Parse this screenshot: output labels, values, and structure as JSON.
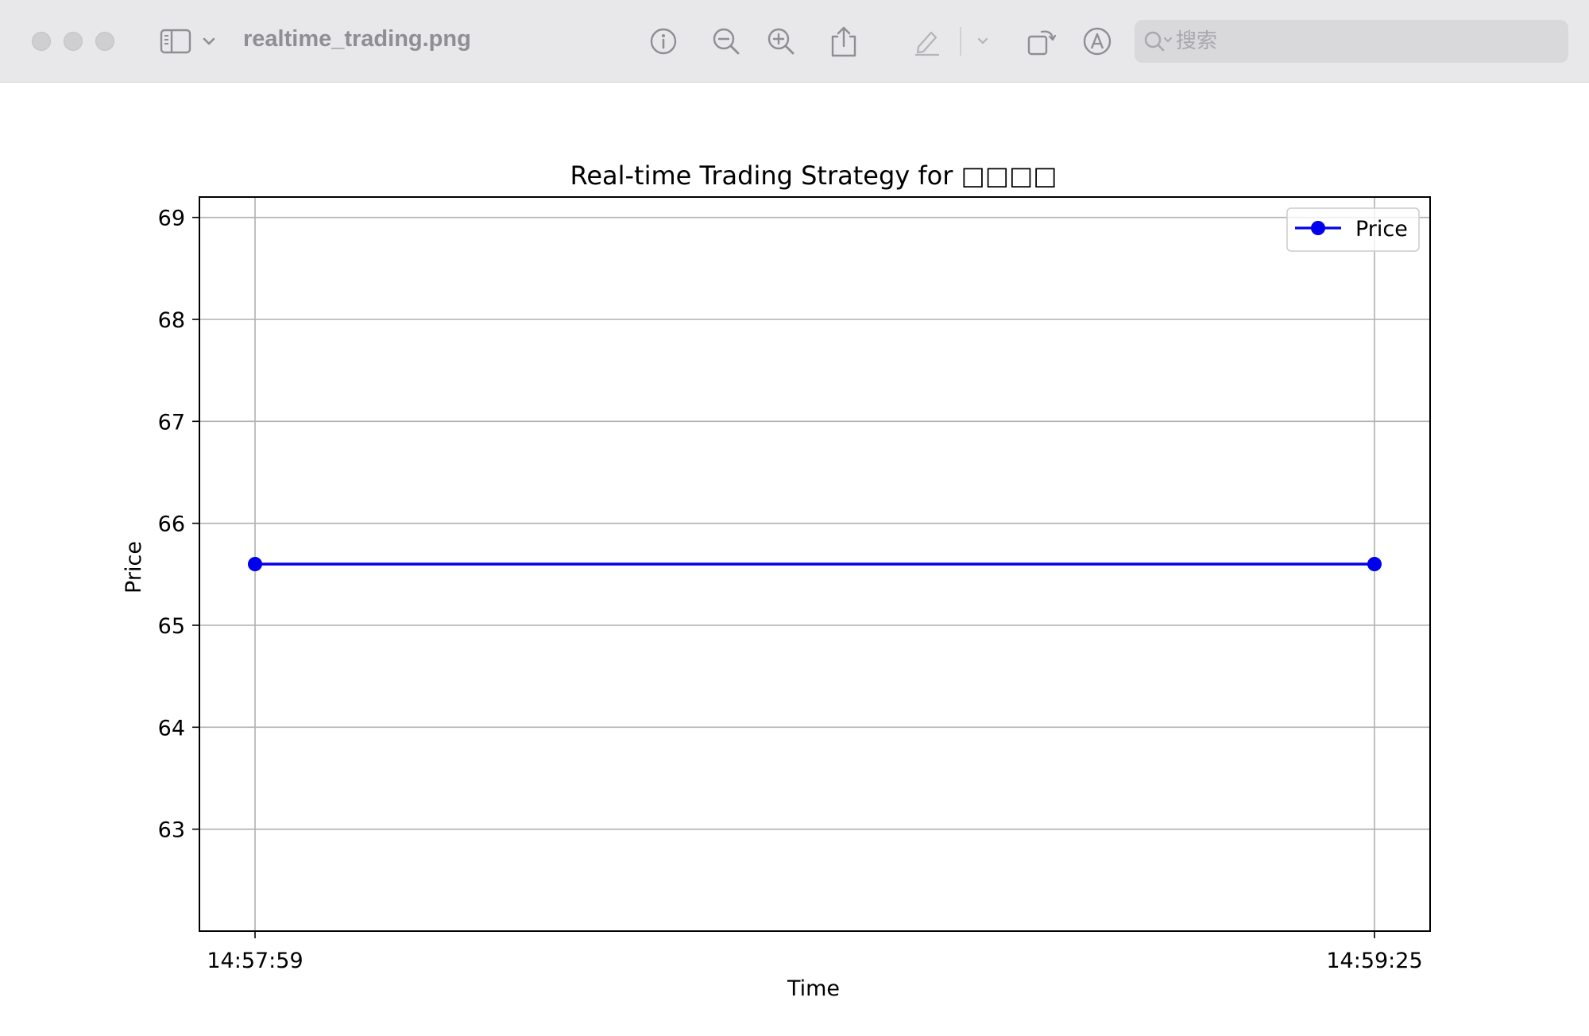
{
  "window": {
    "title": "realtime_trading.png"
  },
  "toolbar": {
    "icons": [
      "sidebar-icon",
      "chevron-down-icon",
      "info-icon",
      "zoom-out-icon",
      "zoom-in-icon",
      "share-icon",
      "markup-pen-icon",
      "chevron-down-icon",
      "rotate-icon",
      "annotate-icon",
      "search-icon"
    ]
  },
  "search": {
    "placeholder": "搜索"
  },
  "colors": {
    "series": "#0000ee",
    "grid": "#b0b0b0",
    "toolbar_bg": "#e8e8ea"
  },
  "chart_data": {
    "type": "line",
    "title": "Real-time Trading Strategy for □□□□",
    "xlabel": "Time",
    "ylabel": "Price",
    "x": [
      "14:57:59",
      "14:59:25"
    ],
    "series": [
      {
        "name": "Price",
        "values": [
          65.6,
          65.6
        ],
        "color": "#0000ee",
        "marker": "circle"
      }
    ],
    "yticks": [
      63,
      64,
      65,
      66,
      67,
      68,
      69
    ],
    "ylim": [
      62.0,
      69.2
    ],
    "grid": true,
    "legend": "top-right"
  }
}
